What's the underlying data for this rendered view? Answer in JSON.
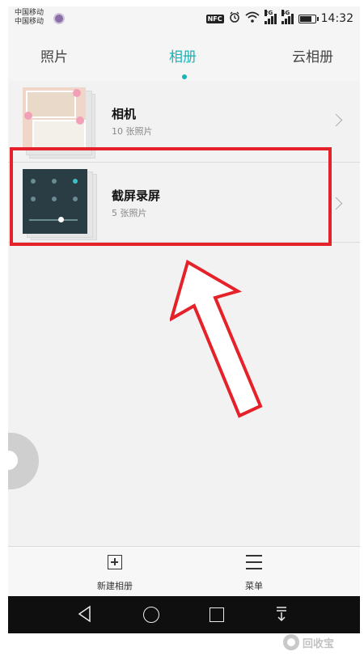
{
  "status_bar": {
    "carrier_1": "中国移动",
    "carrier_2": "中国移动",
    "nfc": "NFC",
    "net_2g": "2G",
    "net_4g": "4G",
    "time": "14:32",
    "battery_level": 0.85
  },
  "tabs": [
    {
      "label": "照片"
    },
    {
      "label": "相册"
    },
    {
      "label": "云相册"
    }
  ],
  "active_tab": "相册",
  "albums": [
    {
      "name": "相机",
      "count": "10 张照片"
    },
    {
      "name": "截屏录屏",
      "count": "5 张照片"
    }
  ],
  "toolbar": {
    "new_album": "新建相册",
    "menu": "菜单"
  },
  "watermark": "回收宝",
  "colors": {
    "accent": "#17b3b8",
    "highlight": "#e5222a",
    "nav_bg": "#0f0f0f"
  },
  "icons": [
    "nfc-icon",
    "alarm-icon",
    "wifi-icon",
    "signal-icon",
    "battery-icon",
    "chevron-right-icon",
    "new-album-icon",
    "menu-icon",
    "back-icon",
    "home-icon",
    "recent-apps-icon",
    "notification-icon"
  ]
}
